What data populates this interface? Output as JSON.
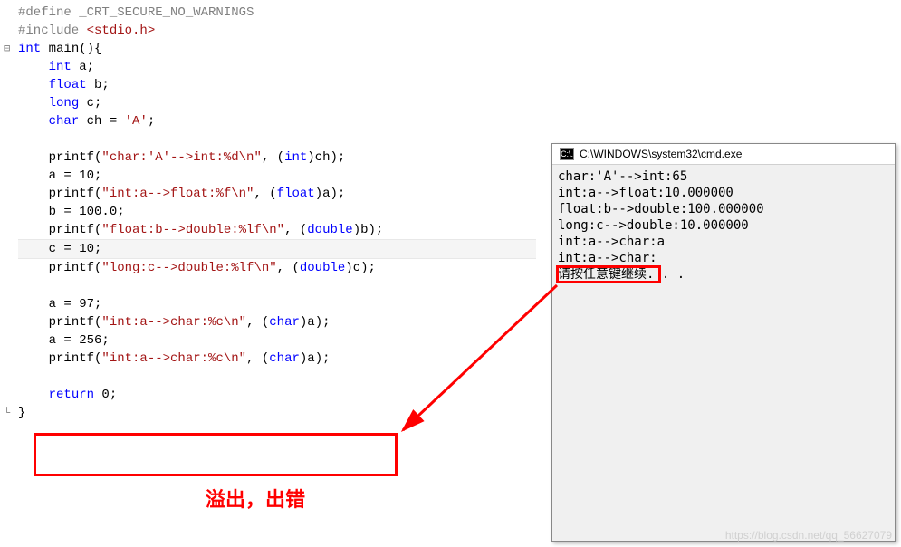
{
  "code": {
    "l1": "#define _CRT_SECURE_NO_WARNINGS",
    "l2a": "#include ",
    "l2b": "<stdio.h>",
    "l3a": "int",
    "l3b": " main(){",
    "l4a": "int",
    "l4b": " a;",
    "l5a": "float",
    "l5b": " b;",
    "l6a": "long",
    "l6b": " c;",
    "l7a": "char",
    "l7b": " ch = ",
    "l7c": "'A'",
    "l7d": ";",
    "l9a": "printf(",
    "l9b": "\"char:'A'-->int:%d\\n\"",
    "l9c": ", (",
    "l9d": "int",
    "l9e": ")ch);",
    "l10": "    a = 10;",
    "l11a": "printf(",
    "l11b": "\"int:a-->float:%f\\n\"",
    "l11c": ", (",
    "l11d": "float",
    "l11e": ")a);",
    "l12": "    b = 100.0;",
    "l13a": "printf(",
    "l13b": "\"float:b-->double:%lf\\n\"",
    "l13c": ", (",
    "l13d": "double",
    "l13e": ")b);",
    "l14": "    c = 10;",
    "l15a": "printf(",
    "l15b": "\"long:c-->double:%lf\\n\"",
    "l15c": ", (",
    "l15d": "double",
    "l15e": ")c);",
    "l17": "    a = 97;",
    "l18a": "printf(",
    "l18b": "\"int:a-->char:%c\\n\"",
    "l18c": ", (",
    "l18d": "char",
    "l18e": ")a);",
    "l19": "    a = 256;",
    "l20a": "printf(",
    "l20b": "\"int:a-->char:%c\\n\"",
    "l20c": ", (",
    "l20d": "char",
    "l20e": ")a);",
    "l22a": "return",
    "l22b": " 0;",
    "l23": "}"
  },
  "console": {
    "title": "C:\\WINDOWS\\system32\\cmd.exe",
    "icon": "C:\\.",
    "output": "char:'A'-->int:65\nint:a-->float:10.000000\nfloat:b-->double:100.000000\nlong:c-->double:10.000000\nint:a-->char:a\nint:a-->char:\n请按任意键继续. . ."
  },
  "annotation": {
    "overflow_label": "溢出，出错"
  },
  "watermark": "https://blog.csdn.net/qq_56627079"
}
